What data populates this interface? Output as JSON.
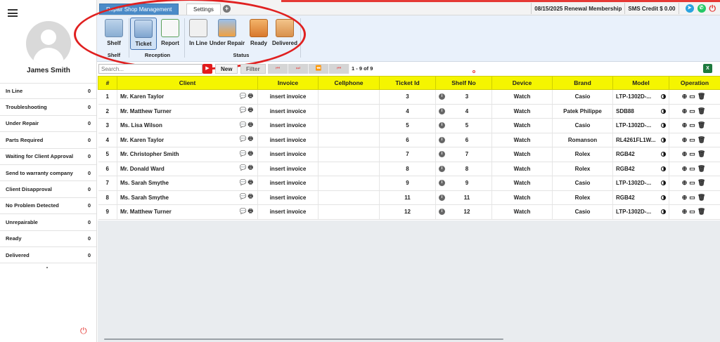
{
  "user": {
    "name": "James Smith"
  },
  "statuses": [
    {
      "label": "In Line",
      "count": "0"
    },
    {
      "label": "Troubleshooting",
      "count": "0"
    },
    {
      "label": "Under Repair",
      "count": "0"
    },
    {
      "label": "Parts Required",
      "count": "0"
    },
    {
      "label": "Waiting for Client Approval",
      "count": "0"
    },
    {
      "label": "Send to warranty company",
      "count": "0"
    },
    {
      "label": "Client Disapproval",
      "count": "0"
    },
    {
      "label": "No Problem Detected",
      "count": "0"
    },
    {
      "label": "Unrepairable",
      "count": "0"
    },
    {
      "label": "Ready",
      "count": "0"
    },
    {
      "label": "Delivered",
      "count": "0"
    }
  ],
  "tabs": {
    "main": "Repair Shop Management",
    "settings": "Settings"
  },
  "topbar": {
    "date_renewal": "08/15/2025 Renewal Membership",
    "sms_credit": "SMS Credit $ 0.00"
  },
  "ribbon": {
    "shelf": "Shelf",
    "ticket": "Ticket",
    "report": "Report",
    "inline": "In Line",
    "under_repair": "Under Repair",
    "ready": "Ready",
    "delivered": "Delivered",
    "groups": {
      "shelf": "Shelf",
      "reception": "Reception",
      "status": "Status"
    }
  },
  "toolbar": {
    "search_placeholder": "Search...",
    "new_label": "New",
    "filter_label": "Filter",
    "page_info": "1 - 9 of 9",
    "excel_label": "X"
  },
  "table": {
    "headers": [
      "#",
      "Client",
      "Invoice",
      "Cellphone",
      "Ticket Id",
      "Shelf No",
      "Device",
      "Brand",
      "Model",
      "Operation"
    ],
    "rows": [
      {
        "num": "1",
        "client": "Mr. Karen Taylor",
        "invoice": "insert invoice",
        "cellphone": "",
        "ticket": "3",
        "shelf": "3",
        "device": "Watch",
        "brand": "Casio",
        "model": "LTP-1302D-..."
      },
      {
        "num": "2",
        "client": "Mr. Matthew Turner",
        "invoice": "insert invoice",
        "cellphone": "",
        "ticket": "4",
        "shelf": "4",
        "device": "Watch",
        "brand": "Patek Philippe",
        "model": "SDB88"
      },
      {
        "num": "3",
        "client": "Ms. Lisa Wilson",
        "invoice": "insert invoice",
        "cellphone": "",
        "ticket": "5",
        "shelf": "5",
        "device": "Watch",
        "brand": "Casio",
        "model": "LTP-1302D-..."
      },
      {
        "num": "4",
        "client": "Mr. Karen Taylor",
        "invoice": "insert invoice",
        "cellphone": "",
        "ticket": "6",
        "shelf": "6",
        "device": "Watch",
        "brand": "Romanson",
        "model": "RL4261FL1W..."
      },
      {
        "num": "5",
        "client": "Mr. Christopher Smith",
        "invoice": "insert invoice",
        "cellphone": "",
        "ticket": "7",
        "shelf": "7",
        "device": "Watch",
        "brand": "Rolex",
        "model": "RGB42"
      },
      {
        "num": "6",
        "client": "Mr. Donald Ward",
        "invoice": "insert invoice",
        "cellphone": "",
        "ticket": "8",
        "shelf": "8",
        "device": "Watch",
        "brand": "Rolex",
        "model": "RGB42"
      },
      {
        "num": "7",
        "client": "Ms. Sarah Smythe",
        "invoice": "insert invoice",
        "cellphone": "",
        "ticket": "9",
        "shelf": "9",
        "device": "Watch",
        "brand": "Casio",
        "model": "LTP-1302D-..."
      },
      {
        "num": "8",
        "client": "Ms. Sarah Smythe",
        "invoice": "insert invoice",
        "cellphone": "",
        "ticket": "11",
        "shelf": "11",
        "device": "Watch",
        "brand": "Rolex",
        "model": "RGB42"
      },
      {
        "num": "9",
        "client": "Mr. Matthew Turner",
        "invoice": "insert invoice",
        "cellphone": "",
        "ticket": "12",
        "shelf": "12",
        "device": "Watch",
        "brand": "Casio",
        "model": "LTP-1302D-..."
      }
    ]
  },
  "icons": {
    "menu": "hamburger-icon",
    "power": "power-icon",
    "telegram": "telegram-icon",
    "whatsapp": "whatsapp-icon",
    "youtube": "youtube-icon",
    "excel": "excel-icon",
    "chat": "chat-icon",
    "print": "print-icon",
    "info": "info-icon",
    "add": "add-circle-icon",
    "monitor": "monitor-icon",
    "trash": "trash-icon"
  },
  "colors": {
    "tab_active": "#4b8bc8",
    "header_yellow": "#f5f500",
    "annotation_red": "#e02020",
    "ribbon_bg": "#e9f1fb"
  }
}
